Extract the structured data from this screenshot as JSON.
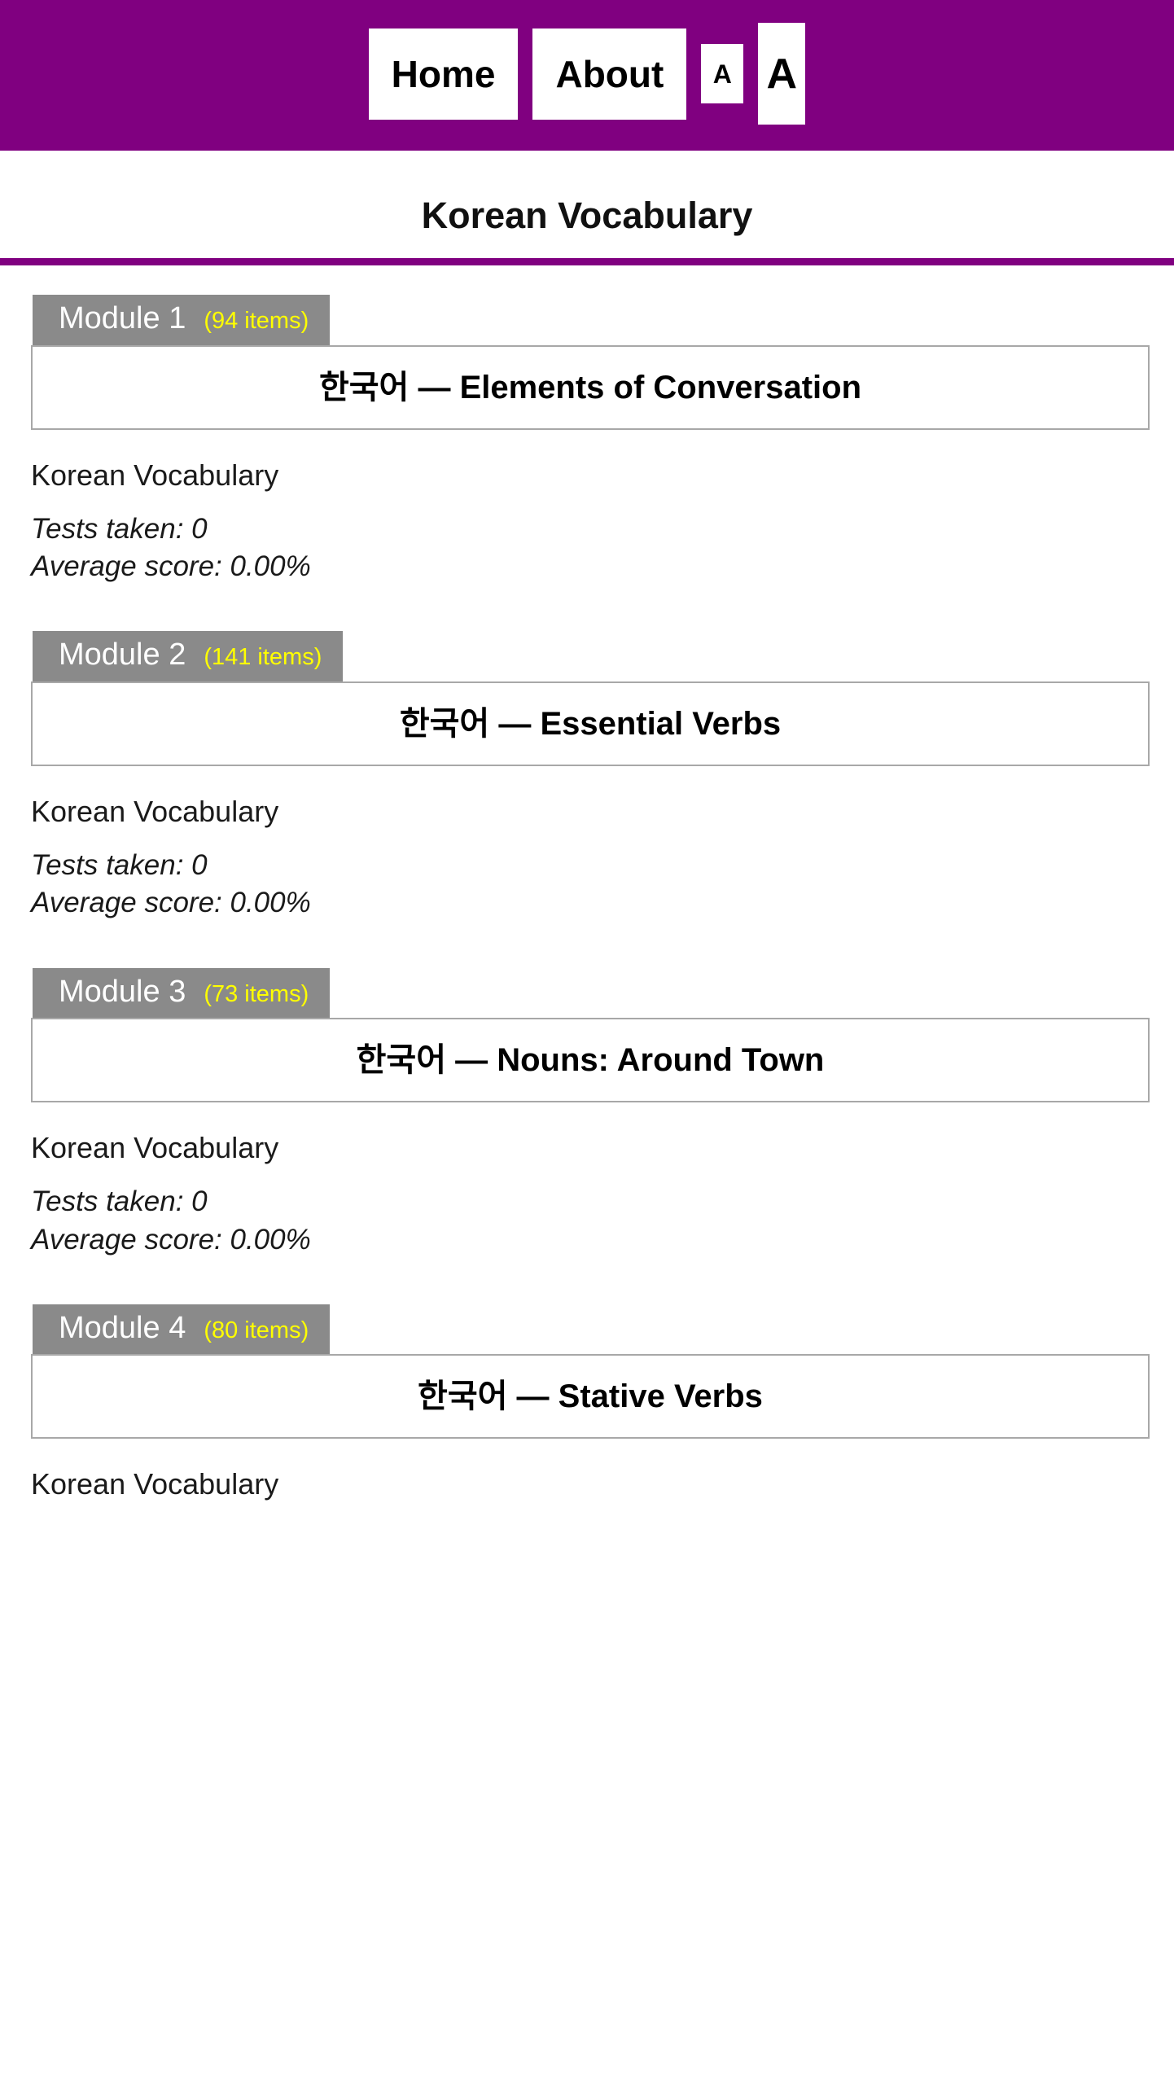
{
  "navbar": {
    "background_color": "#800080",
    "items": [
      {
        "label": "Home",
        "name": "nav-home"
      },
      {
        "label": "About",
        "name": "nav-about"
      },
      {
        "label": "A",
        "name": "font-decrease"
      },
      {
        "label": "A",
        "name": "font-increase"
      }
    ]
  },
  "header": {
    "title": "Korean Vocabulary",
    "rule_color": "#800080"
  },
  "colors": {
    "purple": "#800080",
    "badge_gray": "#8a8a8a",
    "count_yellow": "#ffff00",
    "box_border": "#a8a8a8"
  },
  "labels": {
    "subject": "Korean Vocabulary",
    "tests_taken_prefix": "Tests taken:",
    "average_score_prefix": "Average score:"
  },
  "modules": [
    {
      "badge_name": "Module 1",
      "badge_count": "(94 items)",
      "title": "한국어 — Elements of Conversation",
      "subject": "Korean Vocabulary",
      "tests_taken": "Tests taken: 0",
      "average_score": "Average score: 0.00%"
    },
    {
      "badge_name": "Module 2",
      "badge_count": "(141 items)",
      "title": "한국어 — Essential Verbs",
      "subject": "Korean Vocabulary",
      "tests_taken": "Tests taken: 0",
      "average_score": "Average score: 0.00%"
    },
    {
      "badge_name": "Module 3",
      "badge_count": "(73 items)",
      "title": "한국어 — Nouns: Around Town",
      "subject": "Korean Vocabulary",
      "tests_taken": "Tests taken: 0",
      "average_score": "Average score: 0.00%"
    },
    {
      "badge_name": "Module 4",
      "badge_count": "(80 items)",
      "title": "한국어 — Stative Verbs",
      "subject": "Korean Vocabulary",
      "tests_taken": "",
      "average_score": ""
    }
  ]
}
